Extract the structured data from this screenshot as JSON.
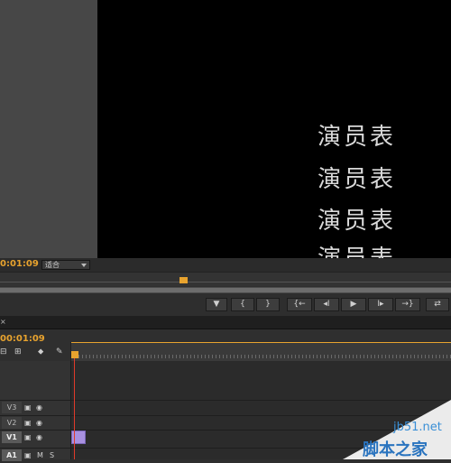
{
  "preview": {
    "credits": [
      "演员表",
      "演员表",
      "演员表",
      "演员表"
    ]
  },
  "program_monitor": {
    "timecode": "0:01:09",
    "fit_select": "适合"
  },
  "transport": {
    "buttons": [
      {
        "name": "add-marker-button",
        "glyph": "▼"
      },
      {
        "name": "mark-in-button",
        "glyph": "{"
      },
      {
        "name": "mark-out-button",
        "glyph": "}"
      },
      {
        "name": "go-to-in-button",
        "glyph": "{←"
      },
      {
        "name": "step-back-button",
        "glyph": "◂I"
      },
      {
        "name": "play-button",
        "glyph": "▶"
      },
      {
        "name": "step-forward-button",
        "glyph": "I▸"
      },
      {
        "name": "go-to-out-button",
        "glyph": "→}"
      },
      {
        "name": "export-frame-button",
        "glyph": "⇄"
      }
    ]
  },
  "timeline": {
    "close_tab": "×",
    "timecode": "00:01:09",
    "tracks": [
      {
        "label": "V3",
        "selected": false
      },
      {
        "label": "V2",
        "selected": false
      },
      {
        "label": "V1",
        "selected": true
      },
      {
        "label": "A1",
        "selected": false,
        "m": "M",
        "s": "S"
      }
    ]
  },
  "watermark": {
    "url": "jb51.net",
    "text": "脚本之家"
  }
}
